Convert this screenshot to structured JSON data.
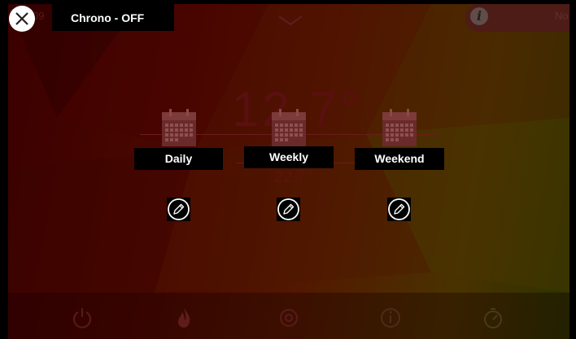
{
  "header": {
    "title": "Chrono - OFF",
    "close_icon": "close-icon"
  },
  "background": {
    "temperature": "12.7°",
    "sub_temperature": "22.7°",
    "top_left_text": "09",
    "info_text": "No",
    "info_icon": "info-icon",
    "chevron_icon": "chevron-down-icon"
  },
  "modes": [
    {
      "label": "Daily",
      "icon": "calendar-icon",
      "edit_icon": "pencil-icon"
    },
    {
      "label": "Weekly",
      "icon": "calendar-icon",
      "edit_icon": "pencil-icon"
    },
    {
      "label": "Weekend",
      "icon": "calendar-icon",
      "edit_icon": "pencil-icon"
    }
  ],
  "bottom_nav": [
    {
      "icon": "power-icon"
    },
    {
      "icon": "flame-icon"
    },
    {
      "icon": "settings-icon"
    },
    {
      "icon": "info-icon"
    },
    {
      "icon": "timer-icon"
    }
  ],
  "colors": {
    "overlay": "#000000",
    "text": "#ffffff",
    "calendar": "#6b2a2a"
  }
}
